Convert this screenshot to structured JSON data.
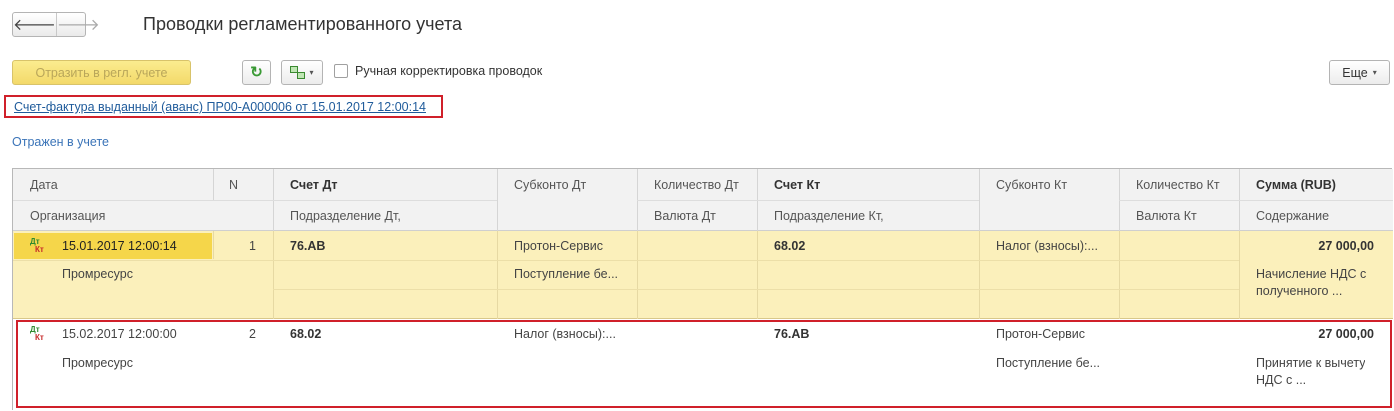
{
  "nav": {
    "back_icon": "arrow-left-icon",
    "forward_icon": "arrow-right-icon",
    "back": "🡐",
    "forward": "🡒"
  },
  "title": "Проводки регламентированного учета",
  "toolbar": {
    "post_label": "Отразить в регл. учете",
    "refresh_icon": "refresh-icon",
    "refresh_glyph": "↻",
    "struct_icon": "structure-icon",
    "caret": "▾",
    "manual_label": "Ручная корректировка проводок",
    "more_label": "Еще"
  },
  "document_link": "Счет-фактура выданный (аванс) ПР00-А000006 от 15.01.2017 12:00:14",
  "status": "Отражен в учете",
  "columns": {
    "row1": [
      "Дата",
      "N",
      "Счет Дт",
      "Субконто Дт",
      "Количество Дт",
      "Счет Кт",
      "Субконто Кт",
      "Количество Кт",
      "Сумма (RUB)"
    ],
    "row2": [
      "Организация",
      "Подразделение Дт,",
      "Валюта Дт",
      "Подразделение Кт,",
      "Валюта Кт",
      "Содержание"
    ]
  },
  "rows": [
    {
      "date": "15.01.2017 12:00:14",
      "n": "1",
      "account_dt": "76.АВ",
      "subconto_dt_1": "Протон-Сервис",
      "subconto_dt_2": "Поступление бе...",
      "account_kt": "68.02",
      "subconto_kt_1": "Налог (взносы):...",
      "subconto_kt_2": "",
      "sum": "27 000,00",
      "organization": "Промресурс",
      "content_1": "Начисление НДС с",
      "content_2": "полученного ...",
      "selected": true
    },
    {
      "date": "15.02.2017 12:00:00",
      "n": "2",
      "account_dt": "68.02",
      "subconto_dt_1": "Налог (взносы):...",
      "subconto_dt_2": "",
      "account_kt": "76.АВ",
      "subconto_kt_1": "Протон-Сервис",
      "subconto_kt_2": "Поступление бе...",
      "sum": "27 000,00",
      "organization": "Промресурс",
      "content_1": "Принятие к вычету",
      "content_2": "НДС с ...",
      "selected": false
    }
  ],
  "dtkt_icon": {
    "dt": "Дт",
    "kt": "Кт"
  },
  "colors": {
    "selection": "#fbf0bb",
    "highlight_box": "#d0202a",
    "link": "#1f5b9b"
  }
}
